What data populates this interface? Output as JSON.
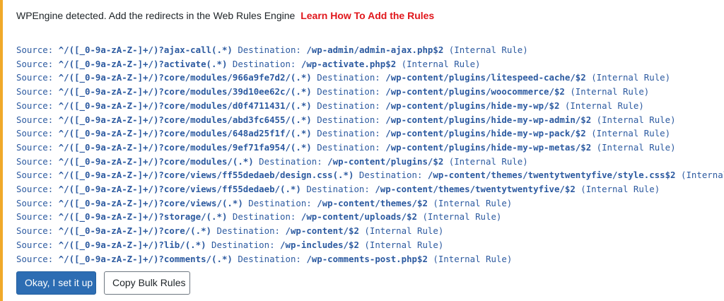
{
  "notice": {
    "message": "WPEngine detected. Add the redirects in the Web Rules Engine",
    "link_label": "Learn How To Add the Rules",
    "accent_color": "#f0a92a",
    "link_color": "#e0161b"
  },
  "labels": {
    "source": "Source:",
    "destination": "Destination:"
  },
  "rules": [
    {
      "source": "^/([_0-9a-zA-Z-]+/)?ajax-call(.*)",
      "destination": "/wp-admin/admin-ajax.php$2",
      "note": "(Internal Rule)"
    },
    {
      "source": "^/([_0-9a-zA-Z-]+/)?activate(.*)",
      "destination": "/wp-activate.php$2",
      "note": "(Internal Rule)"
    },
    {
      "source": "^/([_0-9a-zA-Z-]+/)?core/modules/966a9fe7d2/(.*)",
      "destination": "/wp-content/plugins/litespeed-cache/$2",
      "note": "(Internal Rule)"
    },
    {
      "source": "^/([_0-9a-zA-Z-]+/)?core/modules/39d10ee62c/(.*)",
      "destination": "/wp-content/plugins/woocommerce/$2",
      "note": "(Internal Rule)"
    },
    {
      "source": "^/([_0-9a-zA-Z-]+/)?core/modules/d0f4711431/(.*)",
      "destination": "/wp-content/plugins/hide-my-wp/$2",
      "note": "(Internal Rule)"
    },
    {
      "source": "^/([_0-9a-zA-Z-]+/)?core/modules/abd3fc6455/(.*)",
      "destination": "/wp-content/plugins/hide-my-wp-admin/$2",
      "note": "(Internal Rule)"
    },
    {
      "source": "^/([_0-9a-zA-Z-]+/)?core/modules/648ad25f1f/(.*)",
      "destination": "/wp-content/plugins/hide-my-wp-pack/$2",
      "note": "(Internal Rule)"
    },
    {
      "source": "^/([_0-9a-zA-Z-]+/)?core/modules/9ef71fa954/(.*)",
      "destination": "/wp-content/plugins/hide-my-wp-metas/$2",
      "note": "(Internal Rule)"
    },
    {
      "source": "^/([_0-9a-zA-Z-]+/)?core/modules/(.*)",
      "destination": "/wp-content/plugins/$2",
      "note": "(Internal Rule)"
    },
    {
      "source": "^/([_0-9a-zA-Z-]+/)?core/views/ff55dedaeb/design.css(.*)",
      "destination": "/wp-content/themes/twentytwentyfive/style.css$2",
      "note": "(Internal"
    },
    {
      "source": "^/([_0-9a-zA-Z-]+/)?core/views/ff55dedaeb/(.*)",
      "destination": "/wp-content/themes/twentytwentyfive/$2",
      "note": "(Internal Rule)"
    },
    {
      "source": "^/([_0-9a-zA-Z-]+/)?core/views/(.*)",
      "destination": "/wp-content/themes/$2",
      "note": "(Internal Rule)"
    },
    {
      "source": "^/([_0-9a-zA-Z-]+/)?storage/(.*)",
      "destination": "/wp-content/uploads/$2",
      "note": "(Internal Rule)"
    },
    {
      "source": "^/([_0-9a-zA-Z-]+/)?core/(.*)",
      "destination": "/wp-content/$2",
      "note": "(Internal Rule)"
    },
    {
      "source": "^/([_0-9a-zA-Z-]+/)?lib/(.*)",
      "destination": "/wp-includes/$2",
      "note": "(Internal Rule)"
    },
    {
      "source": "^/([_0-9a-zA-Z-]+/)?comments/(.*)",
      "destination": "/wp-comments-post.php$2",
      "note": "(Internal Rule)"
    }
  ],
  "buttons": {
    "confirm_label": "Okay, I set it up",
    "copy_label": "Copy Bulk Rules"
  }
}
